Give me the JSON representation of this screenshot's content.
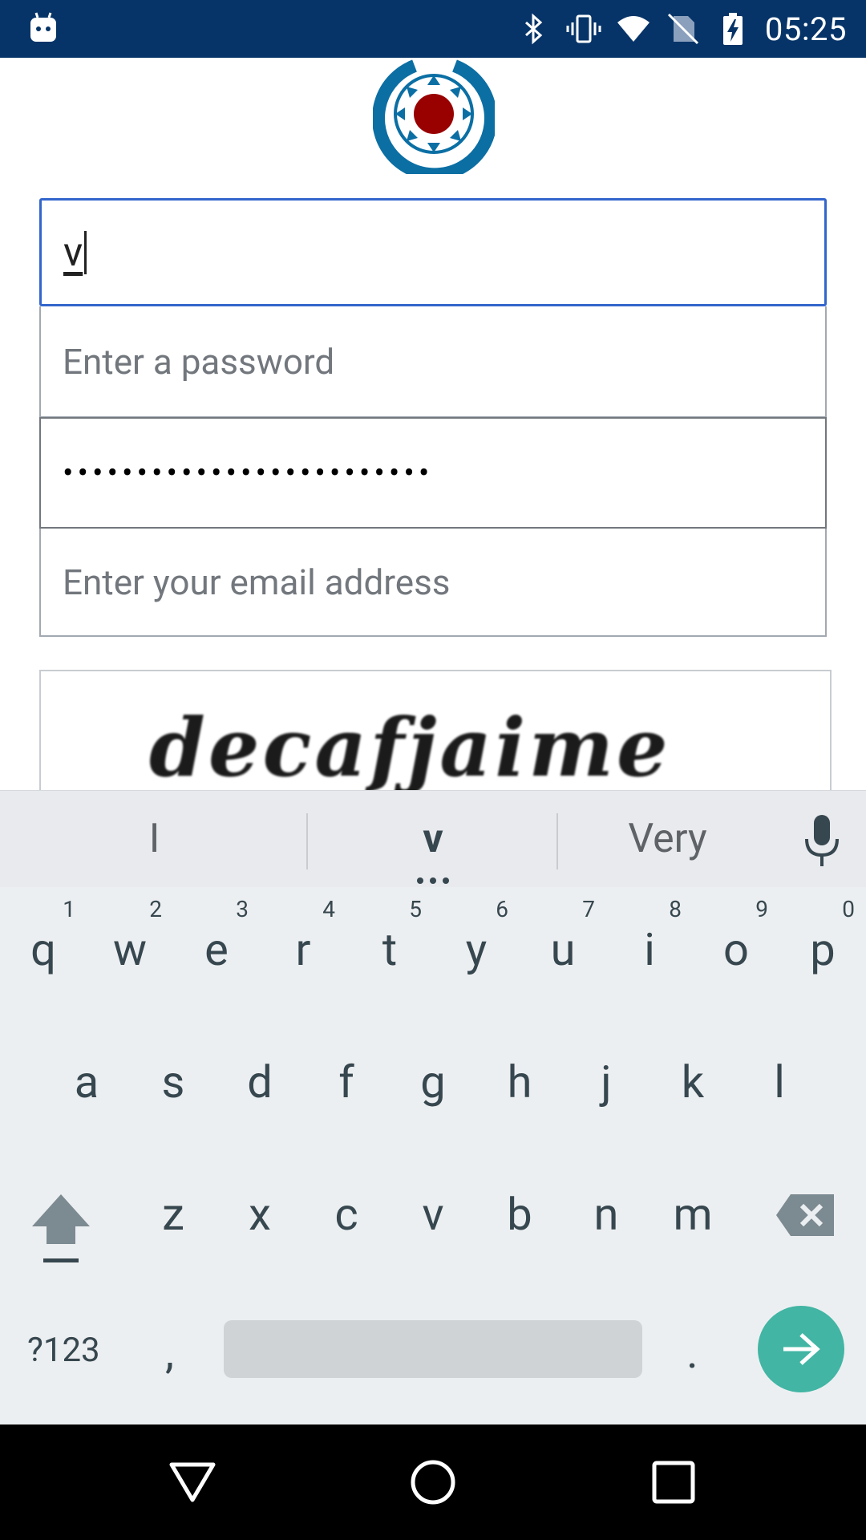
{
  "status_bar": {
    "time": "05:25",
    "icons": [
      "android-notification-icon",
      "bluetooth-icon",
      "vibrate-icon",
      "wifi-icon",
      "no-sim-icon",
      "battery-charging-icon"
    ]
  },
  "form": {
    "username_value": "v",
    "password_placeholder": "Enter a password",
    "password_confirm_dots": "•••••••••••••••••••••••••",
    "email_placeholder": "Enter your email address",
    "captcha_text": "decafjaime",
    "focus_color": "#3366cc"
  },
  "keyboard": {
    "suggestions": [
      "I",
      "v",
      "Very"
    ],
    "row1": [
      {
        "key": "q",
        "hint": "1"
      },
      {
        "key": "w",
        "hint": "2"
      },
      {
        "key": "e",
        "hint": "3"
      },
      {
        "key": "r",
        "hint": "4"
      },
      {
        "key": "t",
        "hint": "5"
      },
      {
        "key": "y",
        "hint": "6"
      },
      {
        "key": "u",
        "hint": "7"
      },
      {
        "key": "i",
        "hint": "8"
      },
      {
        "key": "o",
        "hint": "9"
      },
      {
        "key": "p",
        "hint": "0"
      }
    ],
    "row2": [
      "a",
      "s",
      "d",
      "f",
      "g",
      "h",
      "j",
      "k",
      "l"
    ],
    "row3": [
      "z",
      "x",
      "c",
      "v",
      "b",
      "n",
      "m"
    ],
    "symbols_label": "?123",
    "comma_label": ",",
    "period_label": ".",
    "enter_color": "#42b5a4"
  },
  "colors": {
    "status_bar": "#063468",
    "keyboard_bg": "#eceff1"
  }
}
